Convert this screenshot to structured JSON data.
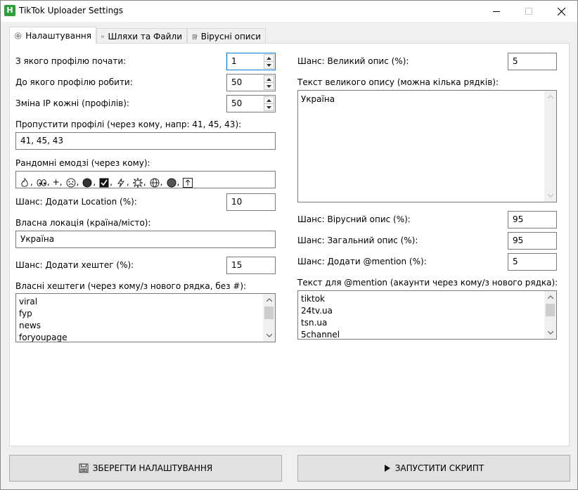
{
  "window": {
    "title": "TikTok Uploader Settings",
    "app_icon_letter": "H"
  },
  "tabs": [
    {
      "label": "Налаштування",
      "icon": "gear-icon"
    },
    {
      "label": "Шляхи та Файли",
      "icon": "folder-icon"
    },
    {
      "label": "Вірусні описи",
      "icon": "notepad-icon"
    }
  ],
  "left": {
    "start_profile": {
      "label": "З якого профілю почати:",
      "value": "1"
    },
    "end_profile": {
      "label": "До якого профілю робити:",
      "value": "50"
    },
    "ip_change": {
      "label": "Зміна IP кожні (профілів):",
      "value": "50"
    },
    "skip_profiles": {
      "label": "Пропустити профілі (через кому, напр: 41, 45, 43):",
      "value": "41, 45, 43"
    },
    "random_emoji": {
      "label": "Рандомні емодзі (через кому):",
      "sep": ",",
      "plus_item": "+,"
    },
    "location_chance": {
      "label": "Шанс: Додати Location (%):",
      "value": "10"
    },
    "own_location": {
      "label": "Власна локація (країна/місто):",
      "value": "Україна"
    },
    "hashtag_chance": {
      "label": "Шанс: Додати хештег (%):",
      "value": "15"
    },
    "own_hashtags": {
      "label": "Власні хештеги (через кому/з нового рядка, без #):",
      "lines": [
        "viral",
        "fyp",
        "news",
        "foryoupage"
      ]
    }
  },
  "right": {
    "big_desc_chance": {
      "label": "Шанс: Великий опис (%):",
      "value": "5"
    },
    "big_desc_text": {
      "label": "Текст великого опису (можна кілька рядків):",
      "lines": [
        "Україна"
      ]
    },
    "viral_desc_chance": {
      "label": "Шанс: Вірусний опис (%):",
      "value": "95"
    },
    "general_desc_chance": {
      "label": "Шанс: Загальний опис (%):",
      "value": "95"
    },
    "mention_chance": {
      "label": "Шанс: Додати @mention (%):",
      "value": "5"
    },
    "mention_text": {
      "label": "Текст для @mention (акаунти через кому/з нового рядка):",
      "lines": [
        "tiktok",
        "24tv.ua",
        "tsn.ua",
        "5channel"
      ]
    }
  },
  "buttons": {
    "save": {
      "label": "ЗБЕРЕГТИ НАЛАШТУВАННЯ",
      "icon": "floppy-disk-icon"
    },
    "run": {
      "label": "ЗАПУСТИТИ СКРИПТ",
      "icon": "play-icon"
    }
  },
  "colors": {
    "focus": "#0078d7",
    "app_icon": "#2e9e3a"
  }
}
